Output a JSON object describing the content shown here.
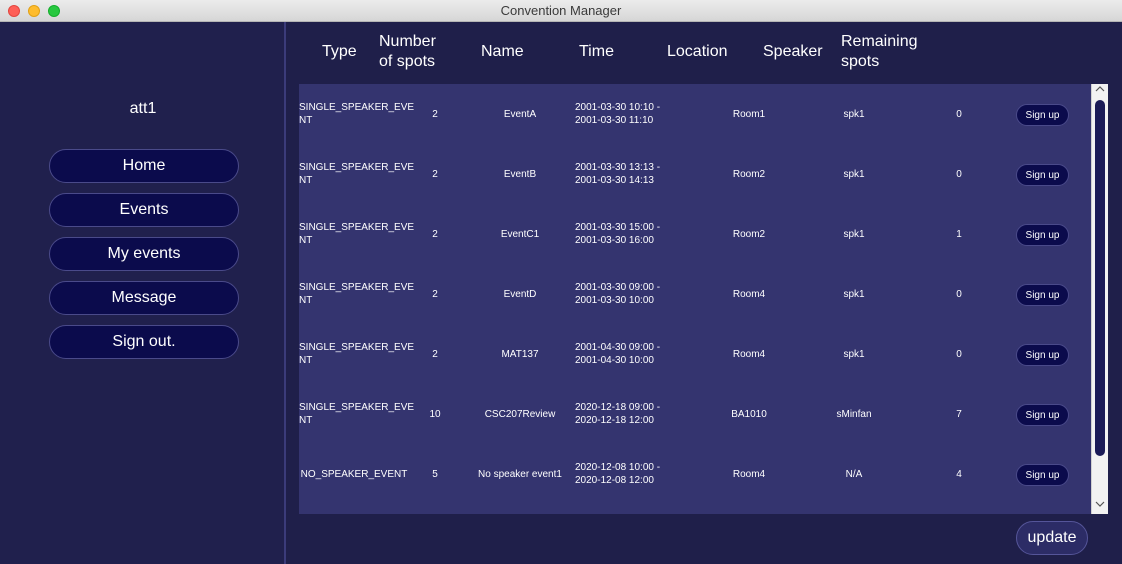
{
  "window": {
    "title": "Convention Manager"
  },
  "sidebar": {
    "username": "att1",
    "nav": [
      {
        "label": "Home"
      },
      {
        "label": "Events"
      },
      {
        "label": "My events"
      },
      {
        "label": "Message"
      },
      {
        "label": "Sign out."
      }
    ]
  },
  "table": {
    "headers": {
      "type": "Type",
      "spots_line1": "Number",
      "spots_line2": "of spots",
      "name": "Name",
      "time": "Time",
      "location": "Location",
      "speaker": "Speaker",
      "remaining_line1": "Remaining",
      "remaining_line2": "spots"
    },
    "rows": [
      {
        "type_line1": "SINGLE_SPEAKER_EVE",
        "type_line2": "NT",
        "spots": "2",
        "name": "EventA",
        "time_line1": "2001-03-30 10:10 -",
        "time_line2": "2001-03-30 11:10",
        "location": "Room1",
        "speaker": "spk1",
        "remaining": "0",
        "action": "Sign up"
      },
      {
        "type_line1": "SINGLE_SPEAKER_EVE",
        "type_line2": "NT",
        "spots": "2",
        "name": "EventB",
        "time_line1": "2001-03-30 13:13 -",
        "time_line2": "2001-03-30 14:13",
        "location": "Room2",
        "speaker": "spk1",
        "remaining": "0",
        "action": "Sign up"
      },
      {
        "type_line1": "SINGLE_SPEAKER_EVE",
        "type_line2": "NT",
        "spots": "2",
        "name": "EventC1",
        "time_line1": "2001-03-30 15:00 -",
        "time_line2": "2001-03-30 16:00",
        "location": "Room2",
        "speaker": "spk1",
        "remaining": "1",
        "action": "Sign up"
      },
      {
        "type_line1": "SINGLE_SPEAKER_EVE",
        "type_line2": "NT",
        "spots": "2",
        "name": "EventD",
        "time_line1": "2001-03-30 09:00 -",
        "time_line2": "2001-03-30 10:00",
        "location": "Room4",
        "speaker": "spk1",
        "remaining": "0",
        "action": "Sign up"
      },
      {
        "type_line1": "SINGLE_SPEAKER_EVE",
        "type_line2": "NT",
        "spots": "2",
        "name": "MAT137",
        "time_line1": "2001-04-30 09:00 -",
        "time_line2": "2001-04-30 10:00",
        "location": "Room4",
        "speaker": "spk1",
        "remaining": "0",
        "action": "Sign up"
      },
      {
        "type_line1": "SINGLE_SPEAKER_EVE",
        "type_line2": "NT",
        "spots": "10",
        "name": "CSC207Review",
        "time_line1": "2020-12-18 09:00 -",
        "time_line2": "2020-12-18 12:00",
        "location": "BA1010",
        "speaker": "sMinfan",
        "remaining": "7",
        "action": "Sign up"
      },
      {
        "type_line1": "NO_SPEAKER_EVENT",
        "type_line2": "",
        "spots": "5",
        "name": "No speaker event1",
        "time_line1": "2020-12-08 10:00 -",
        "time_line2": "2020-12-08 12:00",
        "location": "Room4",
        "speaker": "N/A",
        "remaining": "4",
        "action": "Sign up"
      }
    ]
  },
  "footer": {
    "update_label": "update"
  },
  "icons": {
    "close": "close-icon",
    "minimize": "minimize-icon",
    "maximize": "maximize-icon",
    "scroll_up": "chevron-up-icon",
    "scroll_down": "chevron-down-icon"
  },
  "colors": {
    "background": "#1f1f4a",
    "table_bg": "#34346f",
    "button_bg": "#0b0b4c"
  }
}
